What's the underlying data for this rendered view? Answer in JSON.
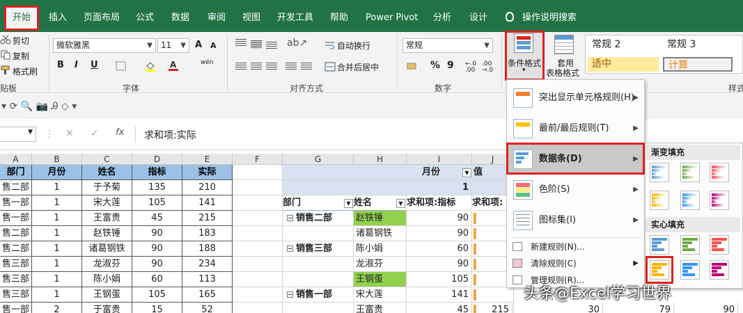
{
  "ribbon": {
    "tabs": [
      "开始",
      "插入",
      "页面布局",
      "公式",
      "数据",
      "审阅",
      "视图",
      "开发工具",
      "帮助",
      "Power Pivot",
      "分析",
      "设计"
    ],
    "tell_me": "操作说明搜索",
    "clipboard": {
      "cut": "剪切",
      "copy": "复制",
      "format_painter": "格式刷",
      "label": "贴板"
    },
    "font": {
      "name": "微软雅黑",
      "size": "11",
      "bold": "B",
      "italic": "I",
      "underline": "U",
      "grow": "A",
      "shrink": "A",
      "phonetic": "wén",
      "label": "字体"
    },
    "alignment": {
      "wrap": "自动换行",
      "merge": "合并后居中",
      "label": "对齐方式"
    },
    "number": {
      "format": "常规",
      "percent": "%",
      "comma": "9",
      "label": "数字"
    },
    "styles": {
      "conditional_format": "条件格式",
      "table_format_line1": "套用",
      "table_format_line2": "表格格式",
      "cells": [
        {
          "text": "常规 2",
          "bg": "#ffffff",
          "color": "#000000"
        },
        {
          "text": "常规 3",
          "bg": "#ffffff",
          "color": "#000000"
        },
        {
          "text": "适中",
          "bg": "#ffeb9c",
          "color": "#9c5700"
        },
        {
          "text": "计算",
          "bg": "#f2f2f2",
          "color": "#fa7d00"
        }
      ],
      "label": "样式"
    }
  },
  "formula_bar": {
    "fx": "fx",
    "content": "求和项:实际"
  },
  "grid": {
    "columns": [
      "A",
      "B",
      "C",
      "D",
      "E",
      "F",
      "G",
      "H",
      "I",
      "J"
    ],
    "source_headers": [
      "部门",
      "月份",
      "姓名",
      "指标",
      "实际"
    ],
    "source_rows": [
      [
        "售二部",
        "1",
        "于予菊",
        "135",
        "210"
      ],
      [
        "售一部",
        "1",
        "宋大莲",
        "105",
        "141"
      ],
      [
        "售一部",
        "1",
        "王富贵",
        "45",
        "215"
      ],
      [
        "售二部",
        "1",
        "赵铁锤",
        "90",
        "183"
      ],
      [
        "售二部",
        "1",
        "诸葛钢铁",
        "90",
        "188"
      ],
      [
        "售三部",
        "1",
        "龙淑芬",
        "90",
        "234"
      ],
      [
        "售三部",
        "1",
        "陈小娟",
        "60",
        "113"
      ],
      [
        "售三部",
        "1",
        "王钢蛋",
        "105",
        "165"
      ],
      [
        "售一部",
        "2",
        "于富贵",
        "15",
        "52"
      ]
    ],
    "pivot": {
      "month_label": "月份",
      "value_label": "值",
      "month_value": "1",
      "dept_header": "部门",
      "name_header": "姓名",
      "target_header": "求和项:指标",
      "actual_header": "求和项:",
      "rows": [
        {
          "dept": "销售二部",
          "name": "赵铁锤",
          "value": "90",
          "highlight": true
        },
        {
          "dept": "",
          "name": "诸葛钢铁",
          "value": "90",
          "highlight": false
        },
        {
          "dept": "销售三部",
          "name": "陈小娟",
          "value": "60",
          "highlight": false
        },
        {
          "dept": "",
          "name": "龙淑芬",
          "value": "90",
          "highlight": false
        },
        {
          "dept": "",
          "name": "王钢蛋",
          "value": "105",
          "highlight": true
        },
        {
          "dept": "销售一部",
          "name": "宋大莲",
          "value": "141",
          "highlight": false
        },
        {
          "dept": "",
          "name": "王富贵",
          "value": "45",
          "highlight": false
        }
      ],
      "bottom_extra": [
        "215",
        "30",
        "79",
        "90"
      ]
    }
  },
  "cf_menu": {
    "items": [
      {
        "label": "突出显示单元格规则(H)"
      },
      {
        "label": "最前/最后规则(T)"
      },
      {
        "label": "数据条(D)"
      },
      {
        "label": "色阶(S)"
      },
      {
        "label": "图标集(I)"
      }
    ],
    "small_items": [
      "新建规则(N)...",
      "清除规则(C)",
      "管理规则(R)..."
    ]
  },
  "databar_menu": {
    "gradient_label": "渐变填充",
    "solid_label": "实心填充",
    "colors": [
      "#5b9bd5",
      "#70ad47",
      "#ff5050",
      "#ffb400",
      "#3399ff",
      "#c0007a"
    ]
  },
  "watermark": "头条@Excel学习世界"
}
